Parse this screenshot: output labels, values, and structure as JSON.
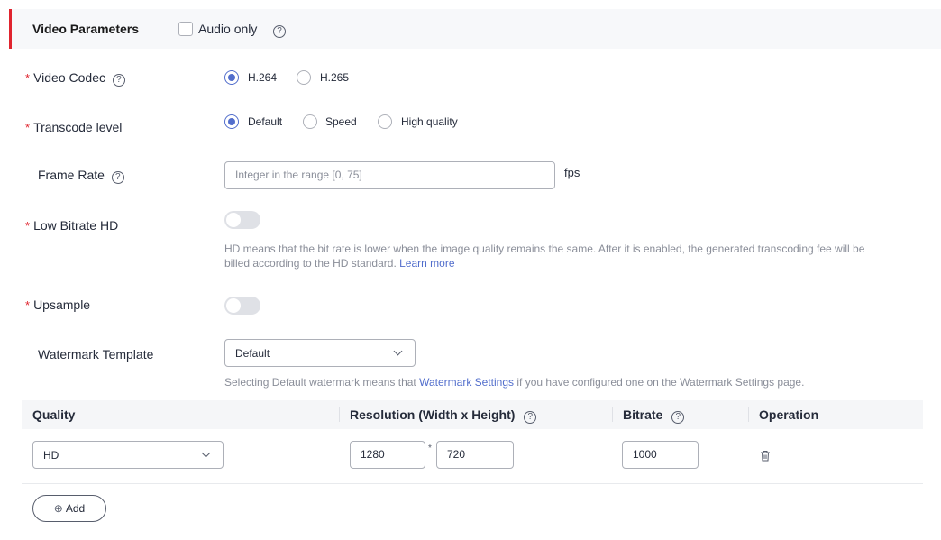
{
  "section": {
    "title": "Video Parameters",
    "audio_only_label": "Audio only",
    "audio_only_checked": false
  },
  "video_codec": {
    "label": "Video Codec",
    "options": [
      "H.264",
      "H.265"
    ],
    "selected": "H.264"
  },
  "transcode_level": {
    "label": "Transcode level",
    "options": [
      "Default",
      "Speed",
      "High quality"
    ],
    "selected": "Default"
  },
  "frame_rate": {
    "label": "Frame Rate",
    "placeholder": "Integer in the range [0, 75]",
    "unit": "fps"
  },
  "low_bitrate_hd": {
    "label": "Low Bitrate HD",
    "enabled": false,
    "hint_line1": "HD means that the bit rate is lower when the image quality remains the same. After it is enabled, the generated transcoding fee will be",
    "hint_line2": "billed according to the HD standard.",
    "learn_more": "Learn more"
  },
  "upsample": {
    "label": "Upsample",
    "enabled": false
  },
  "watermark": {
    "label": "Watermark Template",
    "selected": "Default",
    "hint_prefix": "Selecting Default watermark means that ",
    "hint_link": "Watermark Settings",
    "hint_suffix": " if you have configured one on the Watermark Settings page."
  },
  "table": {
    "columns": {
      "quality": "Quality",
      "resolution": "Resolution (Width x Height)",
      "bitrate": "Bitrate",
      "operation": "Operation"
    },
    "rows": [
      {
        "quality": "HD",
        "width": "1280",
        "height": "720",
        "bitrate": "1000"
      }
    ],
    "resolution_separator": "*",
    "add_label": "Add"
  },
  "help_glyph": "?",
  "required_mark": "*",
  "colors": {
    "accent": "#526ecc",
    "required": "#e0242e",
    "section_bar": "#e0242e"
  }
}
